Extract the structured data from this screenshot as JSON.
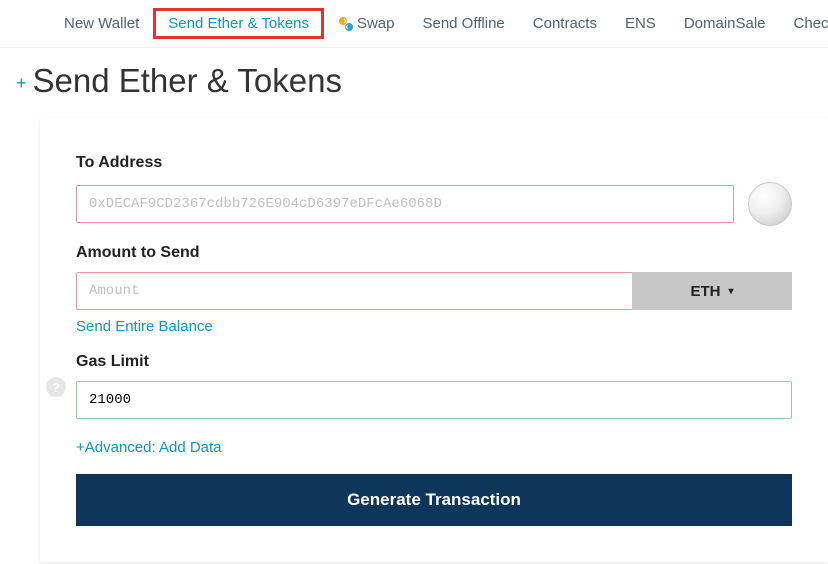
{
  "nav": {
    "items": [
      {
        "label": "New Wallet"
      },
      {
        "label": "Send Ether & Tokens"
      },
      {
        "label": "Swap"
      },
      {
        "label": "Send Offline"
      },
      {
        "label": "Contracts"
      },
      {
        "label": "ENS"
      },
      {
        "label": "DomainSale"
      },
      {
        "label": "Check TX Sta"
      }
    ]
  },
  "page": {
    "title": "Send Ether & Tokens"
  },
  "form": {
    "to_address": {
      "label": "To Address",
      "placeholder": "0xDECAF9CD2367cdbb726E904cD6397eDFcAe6068D"
    },
    "amount": {
      "label": "Amount to Send",
      "placeholder": "Amount",
      "currency": "ETH",
      "send_entire": "Send Entire Balance"
    },
    "gas": {
      "label": "Gas Limit",
      "value": "21000"
    },
    "advanced": "+Advanced: Add Data",
    "generate": "Generate Transaction"
  }
}
